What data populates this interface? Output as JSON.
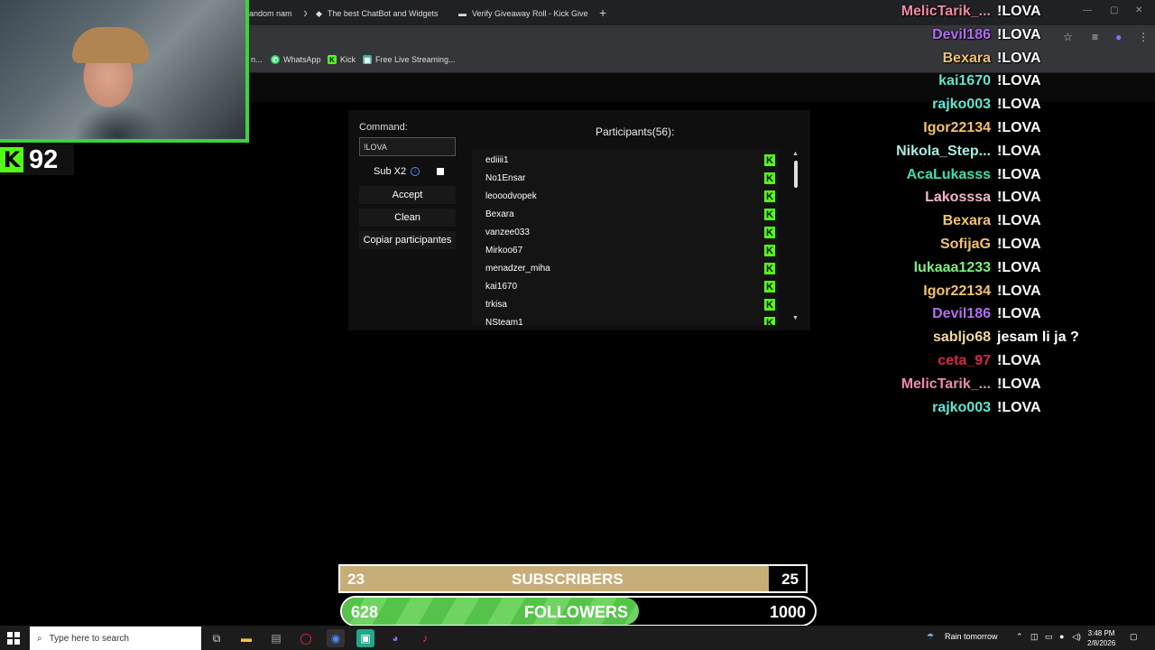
{
  "browser": {
    "tabs": [
      {
        "label": "andom nam",
        "favicon": "page-icon"
      },
      {
        "label": "The best ChatBot and Widgets",
        "favicon": "diamond-icon"
      },
      {
        "label": "Verify Giveaway Roll - Kick Give",
        "favicon": "kick-icon"
      }
    ],
    "new_tab": "+",
    "bookmarks": [
      {
        "label": "n..."
      },
      {
        "label": "WhatsApp"
      },
      {
        "label": "Kick"
      },
      {
        "label": "Free Live Streaming..."
      }
    ]
  },
  "stream": {
    "kick_viewers": "92",
    "kick_logo": "K"
  },
  "giveaway": {
    "command_label": "Command:",
    "command_value": "!LOVA",
    "sub_label": "Sub X2",
    "accept_label": "Accept",
    "clean_label": "Clean",
    "copy_label": "Copiar participantes",
    "participants_title": "Participants(56):",
    "participants": [
      "ediiii1",
      "No1Ensar",
      "leooodvopek",
      "Bexara",
      "vanzee033",
      "Mirkoo67",
      "menadzer_miha",
      "kai1670",
      "trkisa",
      "NSteam1"
    ],
    "badge": "K"
  },
  "chat": [
    {
      "user": "MelicTarik_...",
      "msg": "!LOVA",
      "color": "#ef8ca8"
    },
    {
      "user": "Devil186",
      "msg": "!LOVA",
      "color": "#b46df2"
    },
    {
      "user": "Bexara",
      "msg": "!LOVA",
      "color": "#f2c36b"
    },
    {
      "user": "kai1670",
      "msg": "!LOVA",
      "color": "#5fe8d0"
    },
    {
      "user": "rajko003",
      "msg": "!LOVA",
      "color": "#5fe8d0"
    },
    {
      "user": "Igor22134",
      "msg": "!LOVA",
      "color": "#f2c36b"
    },
    {
      "user": "Nikola_Step...",
      "msg": "!LOVA",
      "color": "#a8ede0"
    },
    {
      "user": "AcaLukasss",
      "msg": "!LOVA",
      "color": "#3ee0a8"
    },
    {
      "user": "Lakosssa",
      "msg": "!LOVA",
      "color": "#f5b7c8"
    },
    {
      "user": "Bexara",
      "msg": "!LOVA",
      "color": "#f2c36b"
    },
    {
      "user": "SofijaG",
      "msg": "!LOVA",
      "color": "#f2c36b"
    },
    {
      "user": "lukaaa1233",
      "msg": "!LOVA",
      "color": "#7ef07e"
    },
    {
      "user": "Igor22134",
      "msg": "!LOVA",
      "color": "#f2c36b"
    },
    {
      "user": "Devil186",
      "msg": "!LOVA",
      "color": "#b46df2"
    },
    {
      "user": "sabljo68",
      "msg": "jesam li ja ?",
      "color": "#f2d9a0"
    },
    {
      "user": "ceta_97",
      "msg": "!LOVA",
      "color": "#d42a4a"
    },
    {
      "user": "MelicTarik_...",
      "msg": "!LOVA",
      "color": "#ef8ca8"
    },
    {
      "user": "rajko003",
      "msg": "!LOVA",
      "color": "#5fe8d0"
    }
  ],
  "goals": {
    "subs_current": "23",
    "subs_label": "SUBSCRIBERS",
    "subs_target": "25",
    "subs_fraction": 0.92,
    "followers_current": "628",
    "followers_label": "FOLLOWERS",
    "followers_target": "1000",
    "followers_fraction": 0.628
  },
  "taskbar": {
    "search_placeholder": "Type here to search",
    "weather": "Rain tomorrow",
    "time": "3:48 PM",
    "date": "2/8/2026"
  }
}
